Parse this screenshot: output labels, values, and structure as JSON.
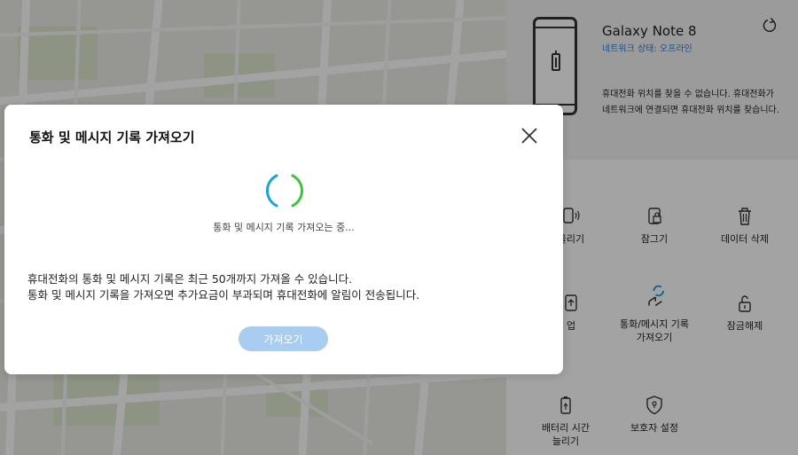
{
  "device": {
    "name": "Galaxy Note 8",
    "status": "네트워크 상태: 오프라인",
    "message": "휴대전화 위치를 찾을 수 없습니다. 휴대전화가 네트워크에 연결되면 휴대전화 위치를 찾습니다."
  },
  "functions": {
    "ring": "울리기",
    "lock": "잠그기",
    "erase": "데이터 삭제",
    "backup": "업",
    "retrieve_calls": "통화/메시지 기록 가져오기",
    "unlock": "잠금해제",
    "battery": "배터리 시간 늘리기",
    "guardian": "보호자 설정"
  },
  "dialog": {
    "title": "통화 및 메시지 기록 가져오기",
    "loading": "통화 및 메시지 기록 가져오는 중...",
    "desc_line1": "휴대전화의 통화 및 메시지 기록은 최근 50개까지 가져올 수 있습니다.",
    "desc_line2": "통화 및 메시지 기록을 가져오면 추가요금이 부과되며 휴대전화에 알림이 전송됩니다.",
    "button": "가져오기"
  },
  "colors": {
    "accent_blue": "#2b7fd6",
    "button_disabled": "#a9cdf0",
    "spinner_blue": "#1aa3d8",
    "spinner_green": "#3cc43c"
  },
  "icons": [
    "refresh-icon",
    "phone-icon",
    "lock-icon",
    "trash-icon",
    "backup-icon",
    "sync-icon",
    "unlock-icon",
    "battery-icon",
    "shield-icon",
    "close-icon",
    "spinner-icon"
  ]
}
